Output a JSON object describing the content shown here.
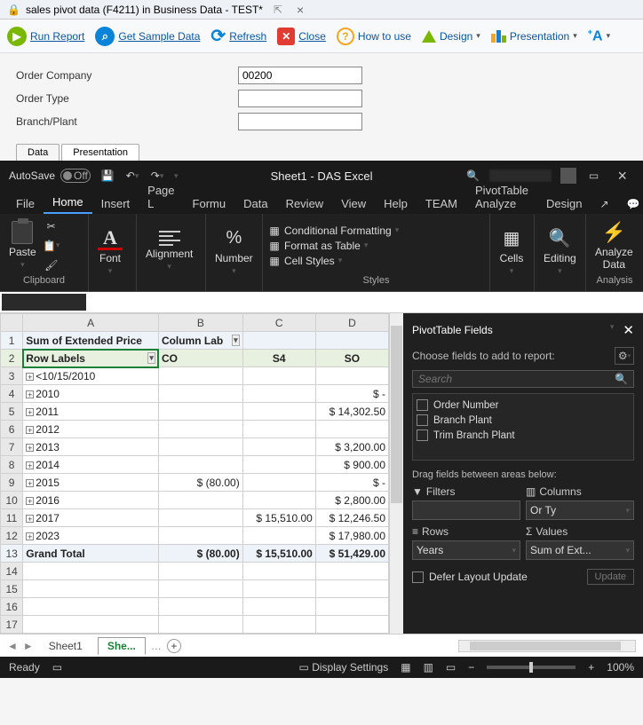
{
  "titleTab": "sales pivot data (F4211) in Business Data - TEST*",
  "toolbar": {
    "run": "Run Report",
    "sample": "Get Sample Data",
    "refresh": "Refresh",
    "close": "Close",
    "howto": "How to use",
    "design": "Design",
    "presentation": "Presentation"
  },
  "form": {
    "company_lbl": "Order Company",
    "company_val": "00200",
    "type_lbl": "Order Type",
    "type_val": "",
    "branch_lbl": "Branch/Plant",
    "branch_val": ""
  },
  "miniTabs": {
    "data": "Data",
    "pres": "Presentation"
  },
  "excel": {
    "autosave": "AutoSave",
    "autosave_state": "Off",
    "docname": "Sheet1 - DAS Excel",
    "tabs": {
      "file": "File",
      "home": "Home",
      "insert": "Insert",
      "page": "Page L",
      "formu": "Formu",
      "data": "Data",
      "review": "Review",
      "view": "View",
      "help": "Help",
      "team": "TEAM",
      "pivot": "PivotTable Analyze",
      "design": "Design"
    },
    "groups": {
      "paste": "Paste",
      "clipboard": "Clipboard",
      "font": "Font",
      "align": "Alignment",
      "number": "Number",
      "condfmt": "Conditional Formatting",
      "fmttable": "Format as Table",
      "cellstyles": "Cell Styles",
      "styles": "Styles",
      "cells": "Cells",
      "editing": "Editing",
      "analyze": "Analyze\nData",
      "analysis": "Analysis"
    }
  },
  "cols": {
    "A": "A",
    "B": "B",
    "C": "C",
    "D": "D"
  },
  "gridHeader": {
    "sum": "Sum of Extended Price",
    "collab": "Column Lab",
    "rows": "Row Labels",
    "co": "CO",
    "s4": "S4",
    "so": "SO"
  },
  "rows": [
    {
      "n": "3",
      "lbl": "<10/15/2010",
      "d": ""
    },
    {
      "n": "4",
      "lbl": "2010",
      "d": "$            -"
    },
    {
      "n": "5",
      "lbl": "2011",
      "d": "$ 14,302.50"
    },
    {
      "n": "6",
      "lbl": "2012",
      "d": ""
    },
    {
      "n": "7",
      "lbl": "2013",
      "d": "$   3,200.00"
    },
    {
      "n": "8",
      "lbl": "2014",
      "d": "$      900.00"
    },
    {
      "n": "9",
      "lbl": "2015",
      "b": "$       (80.00)",
      "d": "$            -"
    },
    {
      "n": "10",
      "lbl": "2016",
      "d": "$   2,800.00"
    },
    {
      "n": "11",
      "lbl": "2017",
      "c": "$ 15,510.00",
      "d": "$ 12,246.50"
    },
    {
      "n": "12",
      "lbl": "2023",
      "d": "$ 17,980.00"
    }
  ],
  "total": {
    "n": "13",
    "lbl": "Grand Total",
    "b": "$       (80.00)",
    "c": "$ 15,510.00",
    "d": "$ 51,429.00"
  },
  "empty": [
    "14",
    "15",
    "16",
    "17"
  ],
  "sheetTabs": {
    "s1": "Sheet1",
    "s2": "She..."
  },
  "fields": {
    "title": "PivotTable Fields",
    "sub": "Choose fields to add to report:",
    "search": "Search",
    "items": [
      "Order Number",
      "Branch Plant",
      "Trim Branch Plant"
    ],
    "drag": "Drag fields between areas below:",
    "filters": "Filters",
    "columns": "Columns",
    "rowslbl": "Rows",
    "values": "Values",
    "colval": "Or Ty",
    "rowval": "Years",
    "valval": "Sum of Ext...",
    "defer": "Defer Layout Update",
    "update": "Update"
  },
  "status": {
    "ready": "Ready",
    "display": "Display Settings",
    "zoom": "100%"
  }
}
